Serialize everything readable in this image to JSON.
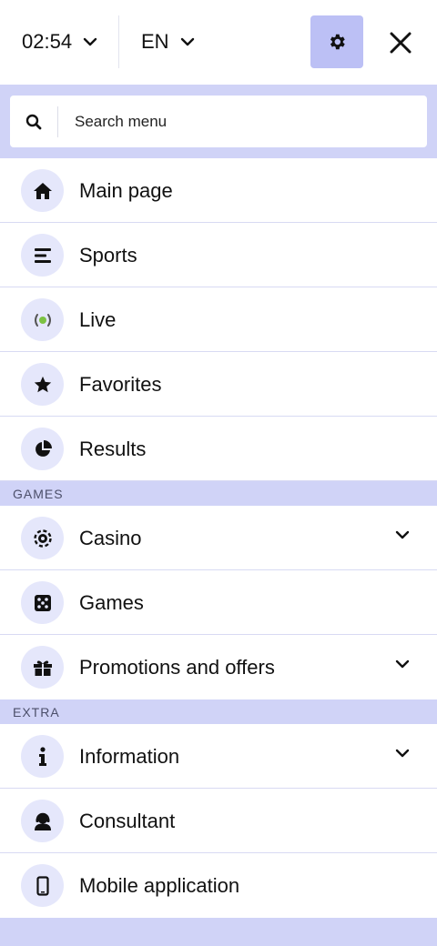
{
  "header": {
    "time": "02:54",
    "language": "EN"
  },
  "search": {
    "placeholder": "Search menu"
  },
  "menu": {
    "main": [
      {
        "label": "Main page",
        "icon": "home-icon"
      },
      {
        "label": "Sports",
        "icon": "sports-list-icon"
      },
      {
        "label": "Live",
        "icon": "live-broadcast-icon"
      },
      {
        "label": "Favorites",
        "icon": "star-icon"
      },
      {
        "label": "Results",
        "icon": "pie-chart-icon"
      }
    ],
    "games_section": "GAMES",
    "games": [
      {
        "label": "Casino",
        "icon": "casino-chip-icon",
        "expandable": true
      },
      {
        "label": "Games",
        "icon": "dice-icon"
      },
      {
        "label": "Promotions and offers",
        "icon": "gift-icon",
        "expandable": true
      }
    ],
    "extra_section": "EXTRA",
    "extra": [
      {
        "label": "Information",
        "icon": "info-icon",
        "expandable": true
      },
      {
        "label": "Consultant",
        "icon": "consultant-icon"
      },
      {
        "label": "Mobile application",
        "icon": "mobile-phone-icon"
      }
    ]
  },
  "colors": {
    "accent_bg": "#d0d3f7",
    "gear_button_bg": "#bcc0f5",
    "icon_circle_bg": "#e5e7fb",
    "live_dot": "#7cc242"
  }
}
